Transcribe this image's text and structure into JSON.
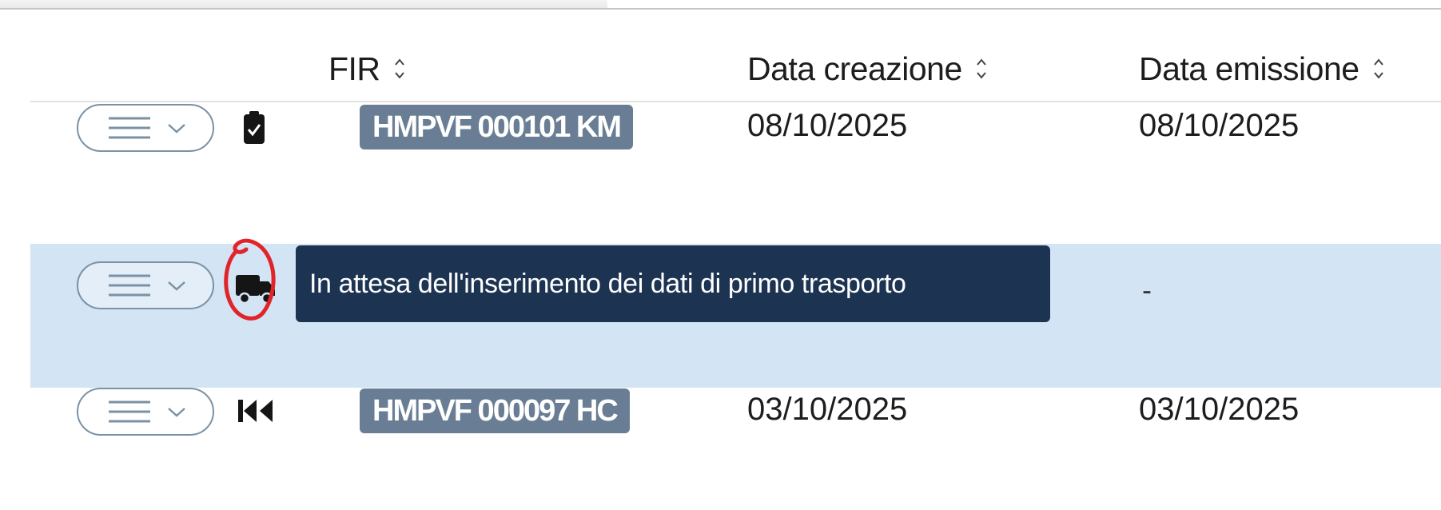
{
  "table": {
    "columns": {
      "fir": "FIR",
      "data_creazione": "Data creazione",
      "data_emissione": "Data emissione"
    },
    "rows": [
      {
        "status_icon": "clipboard-check-icon",
        "fir": "HMPVF 000101 KM",
        "data_creazione": "08/10/2025",
        "data_emissione": "08/10/2025"
      },
      {
        "status_icon": "truck-icon",
        "fir": "",
        "data_creazione": "",
        "data_emissione": "-"
      },
      {
        "status_icon": "fast-rewind-icon",
        "fir": "HMPVF 000097 HC",
        "data_creazione": "03/10/2025",
        "data_emissione": "03/10/2025"
      }
    ]
  },
  "tooltip": {
    "text": "In attesa dell'inserimento dei dati di primo trasporto"
  },
  "icons": {
    "row_menu": "menu-lines-icon",
    "row_menu_caret": "chevron-down-icon",
    "sort": "sort-updown-icon"
  },
  "colors": {
    "fir_tag_bg": "#697e94",
    "selected_row_bg": "#d3e4f4",
    "tooltip_bg": "#1c3452",
    "highlight_annotation": "#e0242a"
  }
}
